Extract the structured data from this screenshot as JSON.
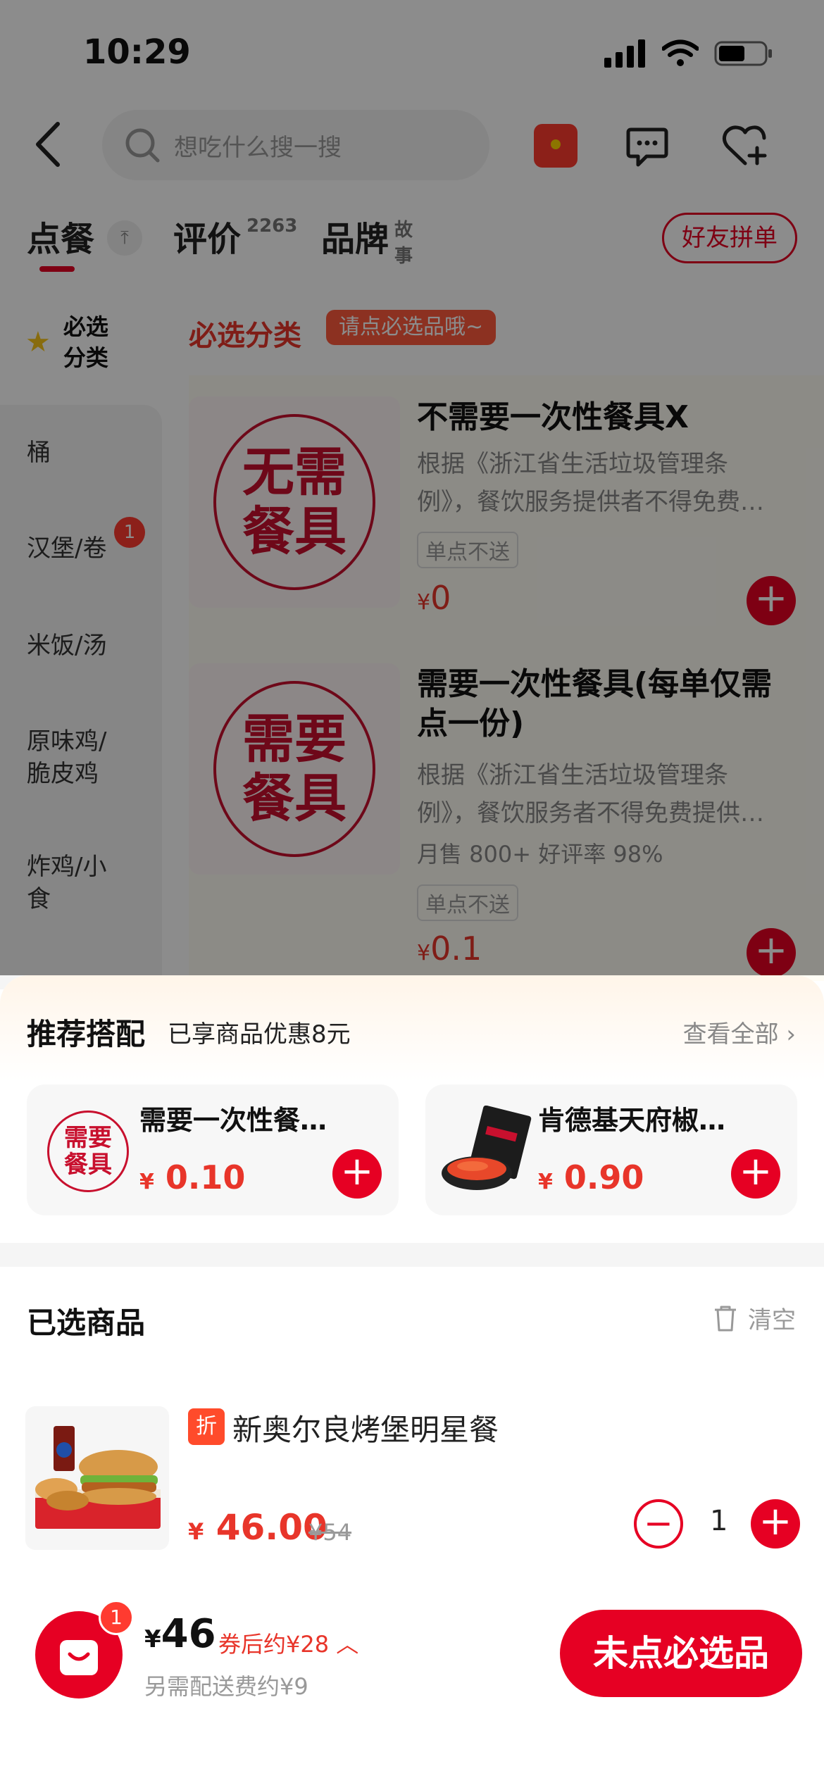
{
  "status": {
    "time": "10:29"
  },
  "header": {
    "search_placeholder": "想吃什么搜一搜"
  },
  "tabs": [
    {
      "label": "点餐",
      "sup": ""
    },
    {
      "label": "评价",
      "sup": "2263"
    },
    {
      "label": "品牌",
      "sup": "故事"
    }
  ],
  "group_order_label": "好友拼单",
  "sidebar": {
    "required_label": "必选分类",
    "items": [
      {
        "label": "桶"
      },
      {
        "label": "汉堡/卷",
        "badge": "1"
      },
      {
        "label": "米饭/汤"
      },
      {
        "label": "原味鸡/脆皮鸡"
      },
      {
        "label": "炸鸡/小食"
      }
    ]
  },
  "section": {
    "title": "必选分类",
    "tag": "请点必选品哦~"
  },
  "products": [
    {
      "seal_text": "无需餐具",
      "name": "不需要一次性餐具X",
      "desc": "根据《浙江省生活垃圾管理条例》，餐饮服务提供者不得免费…",
      "sales": "",
      "tag": "单点不送",
      "currency": "¥",
      "price": "0"
    },
    {
      "seal_text": "需要餐具",
      "name": "需要一次性餐具(每单仅需点一份)",
      "desc": "根据《浙江省生活垃圾管理条例》，餐饮服务者不得免费提供…",
      "sales": "月售 800+ 好评率 98%",
      "tag": "单点不送",
      "currency": "¥",
      "price": "0.1"
    }
  ],
  "recommend": {
    "title": "推荐搭配",
    "subtitle": "已享商品优惠8元",
    "view_all": "查看全部",
    "items": [
      {
        "seal_text": "需要餐具",
        "name": "需要一次性餐…",
        "currency": "¥",
        "price": "0.10"
      },
      {
        "name": "肯德基天府椒…",
        "currency": "¥",
        "price": "0.90"
      }
    ]
  },
  "selected": {
    "title": "已选商品",
    "clear_label": "清空",
    "items": [
      {
        "discount_tag": "折",
        "name": "新奥尔良烤堡明星餐",
        "currency": "¥",
        "price": "46.00",
        "original_price": "¥54",
        "quantity": "1"
      }
    ]
  },
  "cart": {
    "badge": "1",
    "currency": "¥",
    "total": "46",
    "coupon_text": "券后约¥28",
    "delivery_text": "另需配送费约¥9",
    "checkout_label": "未点必选品"
  },
  "colors": {
    "accent": "#e60023",
    "price": "#e8352a"
  }
}
